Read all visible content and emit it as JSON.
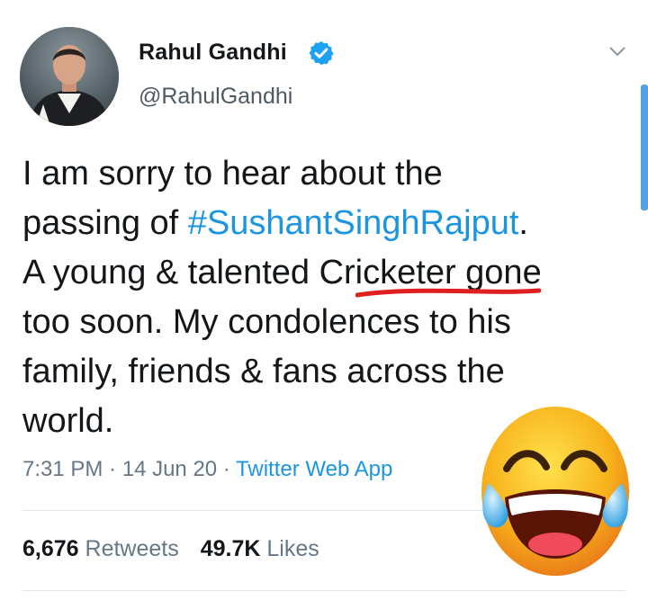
{
  "user": {
    "name": "Rahul Gandhi",
    "handle": "@RahulGandhi",
    "verified_icon": "verified-badge-icon",
    "verified_color": "#1da1f2"
  },
  "tweet": {
    "line1": "I am sorry to hear about the",
    "line2_pre": "passing of ",
    "hashtag": "#SushantSinghRajput",
    "line2_post": ".",
    "line3": "A young & talented Cricketer gone",
    "line4": "too soon. My condolences to his",
    "line5": "family, friends & fans across the",
    "line6": "world."
  },
  "meta": {
    "time": "7:31 PM",
    "sep1": " · ",
    "date": "14 Jun 20",
    "sep2": " · ",
    "source": "Twitter Web App"
  },
  "stats": {
    "retweets_count": "6,676",
    "retweets_label": "Retweets",
    "likes_count": "49.7K",
    "likes_label": "Likes"
  },
  "colors": {
    "hashtag": "#1b95e0",
    "underline": "#e02020",
    "emoji_face": "#f7b21b"
  },
  "icons": {
    "chevron": "chevron-down-icon",
    "emoji": "tears-of-joy-emoji"
  }
}
